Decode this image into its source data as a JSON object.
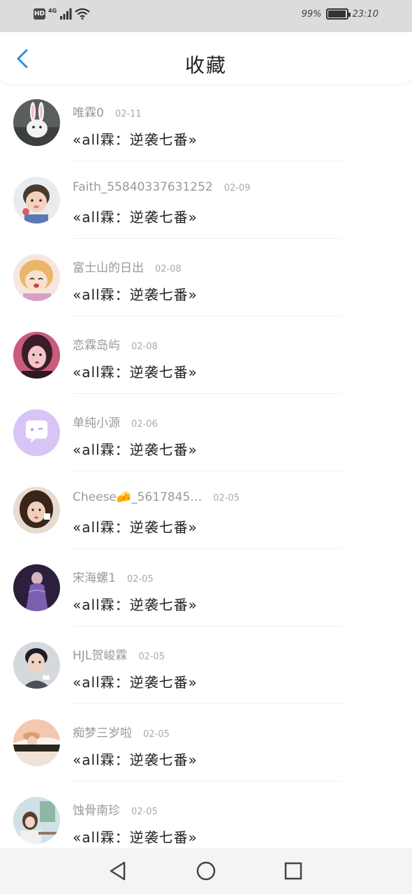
{
  "status_bar": {
    "hd": "HD",
    "network": "4G",
    "battery": "99%",
    "battery_level": 0.99,
    "time": "23:10"
  },
  "header": {
    "title": "收藏",
    "back_icon": "chevron-left-icon",
    "accent": "#2b8fe0"
  },
  "items": [
    {
      "name": "唯霖0",
      "date": "02-11",
      "content": "«all霖：逆袭七番»"
    },
    {
      "name": "Faith_55840337631252",
      "date": "02-09",
      "content": "«all霖：逆袭七番»"
    },
    {
      "name": "富士山的日出",
      "date": "02-08",
      "content": "«all霖：逆袭七番»"
    },
    {
      "name": "恋霖岛屿",
      "date": "02-08",
      "content": "«all霖：逆袭七番»"
    },
    {
      "name": "单纯小源",
      "date": "02-06",
      "content": "«all霖：逆袭七番»"
    },
    {
      "name": "Cheese🧀_5617845…",
      "date": "02-05",
      "content": "«all霖：逆袭七番»"
    },
    {
      "name": "宋海螺1",
      "date": "02-05",
      "content": "«all霖：逆袭七番»"
    },
    {
      "name": "HJL贺峻霖",
      "date": "02-05",
      "content": "«all霖：逆袭七番»"
    },
    {
      "name": "痴梦三岁啦",
      "date": "02-05",
      "content": "«all霖：逆袭七番»"
    },
    {
      "name": "蚀骨南珍",
      "date": "02-05",
      "content": "«all霖：逆袭七番»"
    }
  ],
  "nav_bar": {
    "back_icon": "triangle-back-icon",
    "home_icon": "circle-home-icon",
    "recents_icon": "square-recents-icon"
  }
}
